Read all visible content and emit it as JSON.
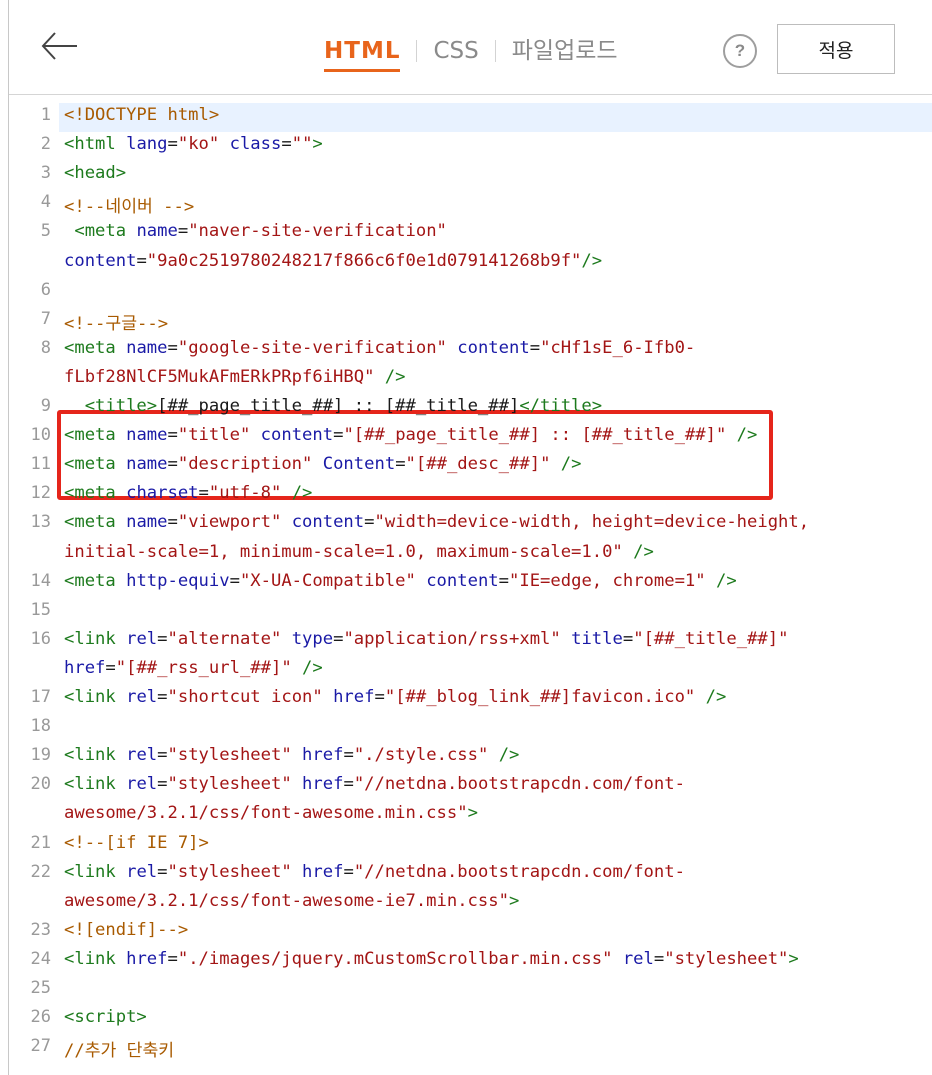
{
  "header": {
    "tabs": [
      {
        "label": "HTML",
        "active": true
      },
      {
        "label": "CSS",
        "active": false
      },
      {
        "label": "파일업로드",
        "active": false
      }
    ],
    "help_label": "?",
    "apply_label": "적용"
  },
  "colors": {
    "accent": "#e8641b",
    "highlight_box": "#e5251b"
  },
  "editor": {
    "line_numbers": [
      "1",
      "2",
      "3",
      "4",
      "5",
      "6",
      "7",
      "8",
      "9",
      "10",
      "11",
      "12",
      "13",
      "14",
      "15",
      "16",
      "17",
      "18",
      "19",
      "20",
      "21",
      "22",
      "23",
      "24",
      "25",
      "26",
      "27"
    ],
    "rows": [
      [
        "<!DOCTYPE html>"
      ],
      [
        "<html",
        " lang",
        "=",
        "\"ko\"",
        " class",
        "=",
        "\"\"",
        ">"
      ],
      [
        "<head>"
      ],
      [
        "<!--네이버 -->"
      ],
      [
        " <meta",
        " name",
        "=",
        "\"naver-site-verification\""
      ],
      [
        "content",
        "=",
        "\"9a0c2519780248217f866c6f0e1d079141268b9f\"",
        "/>"
      ],
      [],
      [
        "<!--구글-->"
      ],
      [
        "<meta",
        " name",
        "=",
        "\"google-site-verification\"",
        " content",
        "=",
        "\"cHf1sE_6-Ifb0-"
      ],
      [
        "fLbf28NlCF5MukAFmERkPRpf6iHBQ\"",
        " />"
      ],
      [
        "  <title>",
        "[##_page_title_##] :: [##_title_##]",
        "</title>"
      ],
      [
        "<meta",
        " name",
        "=",
        "\"title\"",
        " content",
        "=",
        "\"[##_page_title_##] :: [##_title_##]\"",
        " />"
      ],
      [
        "<meta",
        " name",
        "=",
        "\"description\"",
        " Content",
        "=",
        "\"[##_desc_##]\"",
        " />"
      ],
      [
        "<meta",
        " charset",
        "=",
        "\"utf-8\"",
        " />"
      ],
      [
        "<meta",
        " name",
        "=",
        "\"viewport\"",
        " content",
        "=",
        "\"width=device-width, height=device-height,"
      ],
      [
        "initial-scale=1, minimum-scale=1.0, maximum-scale=1.0\"",
        " />"
      ],
      [
        "<meta",
        " http-equiv",
        "=",
        "\"X-UA-Compatible\"",
        " content",
        "=",
        "\"IE=edge, chrome=1\"",
        " />"
      ],
      [],
      [
        "<link",
        " rel",
        "=",
        "\"alternate\"",
        " type",
        "=",
        "\"application/rss+xml\"",
        " title",
        "=",
        "\"[##_title_##]\""
      ],
      [
        "href",
        "=",
        "\"[##_rss_url_##]\"",
        " />"
      ],
      [
        "<link",
        " rel",
        "=",
        "\"shortcut icon\"",
        " href",
        "=",
        "\"[##_blog_link_##]favicon.ico\"",
        " />"
      ],
      [],
      [
        "<link",
        " rel",
        "=",
        "\"stylesheet\"",
        " href",
        "=",
        "\"./style.css\"",
        " />"
      ],
      [
        "<link",
        " rel",
        "=",
        "\"stylesheet\"",
        " href",
        "=",
        "\"//netdna.bootstrapcdn.com/font-"
      ],
      [
        "awesome/3.2.1/css/font-awesome.min.css\"",
        ">"
      ],
      [
        "<!--[if IE 7]>"
      ],
      [
        "<link",
        " rel",
        "=",
        "\"stylesheet\"",
        " href",
        "=",
        "\"//netdna.bootstrapcdn.com/font-"
      ],
      [
        "awesome/3.2.1/css/font-awesome-ie7.min.css\"",
        ">"
      ],
      [
        "<![endif]-->"
      ],
      [
        "<link",
        " href",
        "=",
        "\"./images/jquery.mCustomScrollbar.min.css\"",
        " rel",
        "=",
        "\"stylesheet\"",
        ">"
      ],
      [],
      [
        "<script>"
      ],
      [
        "//추가 단축키"
      ]
    ]
  }
}
